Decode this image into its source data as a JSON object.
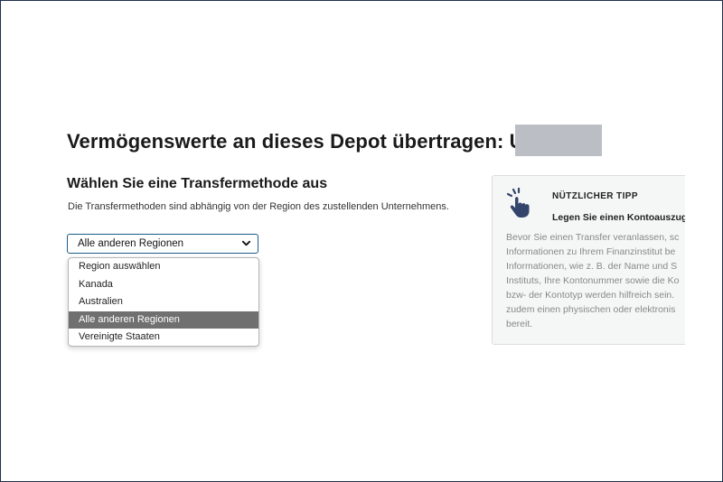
{
  "page": {
    "title": "Vermögenswerte an dieses Depot übertragen: U1",
    "section_title": "Wählen Sie eine Transfermethode aus",
    "description": "Die Transfermethoden sind abhängig von der Region des zustellenden Unternehmens."
  },
  "region_select": {
    "value": "Alle anderen Regionen",
    "options": [
      {
        "label": "Region auswählen"
      },
      {
        "label": "Kanada"
      },
      {
        "label": "Australien"
      },
      {
        "label": "Alle anderen Regionen"
      },
      {
        "label": "Vereinigte Staaten"
      }
    ]
  },
  "tip": {
    "heading": "NÜTZLICHER TIPP",
    "subheading": "Legen Sie einen Kontoauszug",
    "lines": [
      "Bevor Sie einen Transfer veranlassen, sc",
      "Informationen zu Ihrem Finanzinstitut be",
      "Informationen, wie z. B. der Name und S",
      "Instituts, Ihre Kontonummer sowie die Ko",
      "bzw- der Kontotyp werden hilfreich sein.",
      "zudem einen physischen oder elektronis",
      "bereit."
    ]
  },
  "colors": {
    "select_border": "#1c5d86",
    "selected_option_bg": "#707070",
    "tip_icon": "#34456b",
    "redaction": "#bbbfc5"
  }
}
